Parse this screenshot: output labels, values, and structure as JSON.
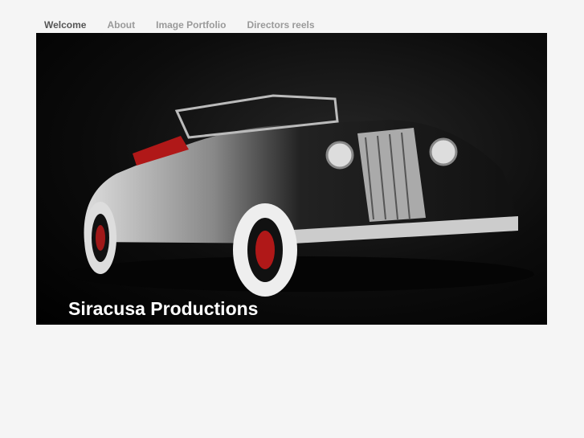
{
  "nav": {
    "items": [
      {
        "label": "Welcome",
        "active": true
      },
      {
        "label": "About",
        "active": false
      },
      {
        "label": "Image Portfolio",
        "active": false
      },
      {
        "label": "Directors reels",
        "active": false
      }
    ]
  },
  "banner": {
    "title": "Siracusa Productions"
  }
}
